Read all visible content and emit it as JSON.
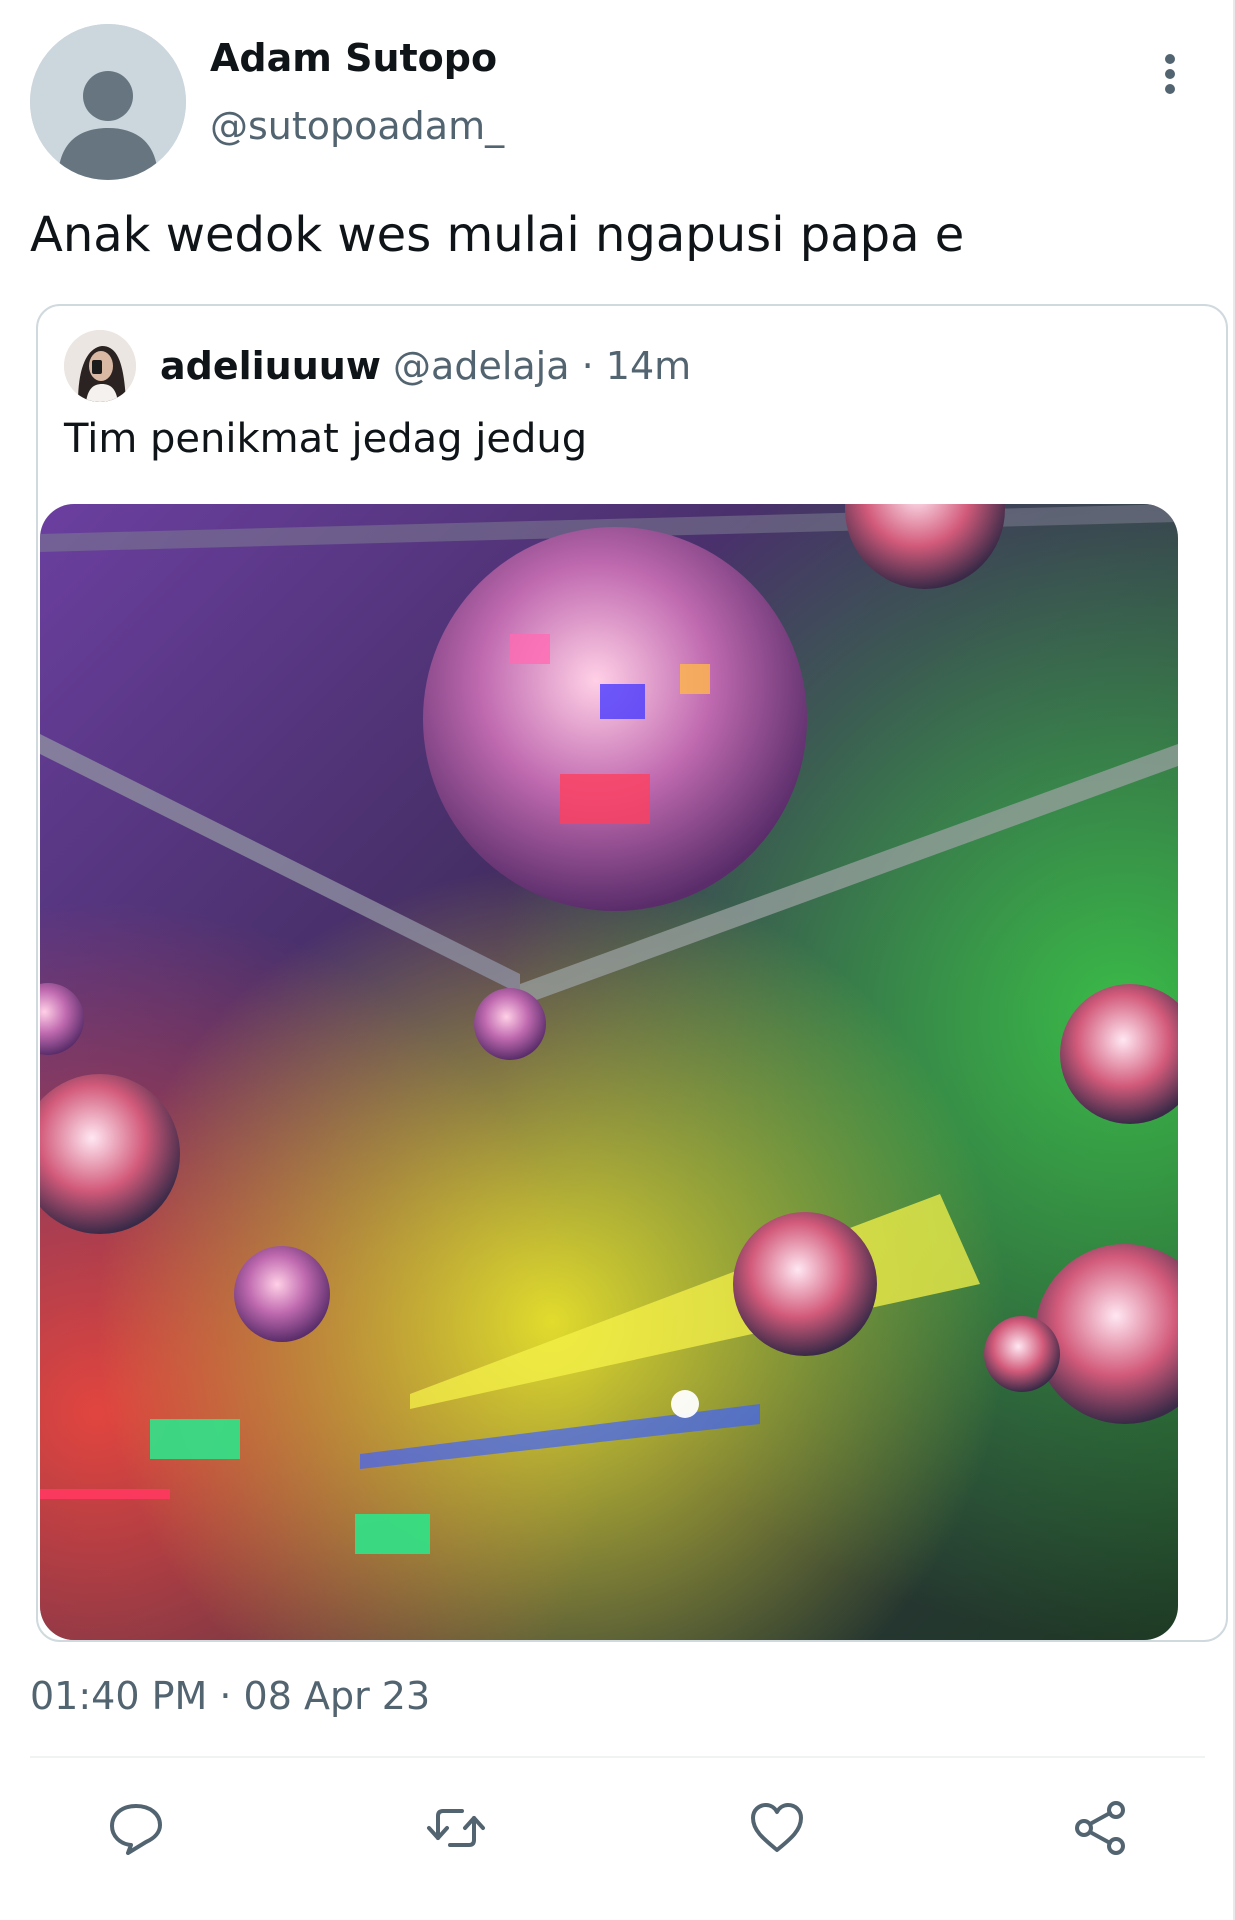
{
  "author": {
    "display_name": "Adam Sutopo",
    "handle": "@sutopoadam_",
    "avatar_icon": "default-profile-icon"
  },
  "tweet": {
    "text": "Anak wedok wes mulai ngapusi papa e",
    "timestamp": "01:40 PM · 08 Apr 23"
  },
  "quoted": {
    "display_name": "adeliuuuw",
    "handle": "@adelaja",
    "separator": "·",
    "time": "14m",
    "text": "Tim penikmat jedag jedug",
    "media_icon": "disco-balls-photo"
  },
  "actions": [
    {
      "icon": "reply-icon"
    },
    {
      "icon": "retweet-icon"
    },
    {
      "icon": "like-icon"
    },
    {
      "icon": "share-icon"
    }
  ],
  "colors": {
    "primary_text": "#0f1419",
    "secondary_text": "#536471",
    "border": "#cfd9de",
    "icon": "#536471"
  }
}
